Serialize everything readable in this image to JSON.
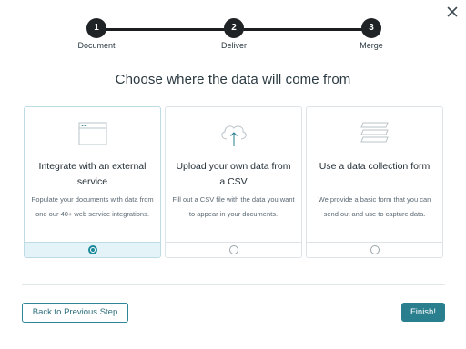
{
  "dialog": {
    "close_icon": "close-icon"
  },
  "stepper": {
    "steps": [
      {
        "number": "1",
        "label": "Document"
      },
      {
        "number": "2",
        "label": "Deliver"
      },
      {
        "number": "3",
        "label": "Merge"
      }
    ]
  },
  "heading": "Choose where the data will come from",
  "options": [
    {
      "icon": "browser-window-icon",
      "title": "Integrate with an external service",
      "description": "Populate your documents with data from one our 40+ web service integrations.",
      "selected": true
    },
    {
      "icon": "cloud-upload-icon",
      "title": "Upload your own data from a CSV",
      "description": "Fill out a CSV file with the data you want to appear in your documents.",
      "selected": false
    },
    {
      "icon": "form-stack-icon",
      "title": "Use a data collection form",
      "description": "We provide a basic form that you can send out and use to capture data.",
      "selected": false
    }
  ],
  "footer": {
    "back_label": "Back to Previous Step",
    "finish_label": "Finish!"
  },
  "colors": {
    "accent": "#2a7f8f",
    "selected_bg": "#e3f3f8",
    "step_circle": "#1f2326"
  }
}
